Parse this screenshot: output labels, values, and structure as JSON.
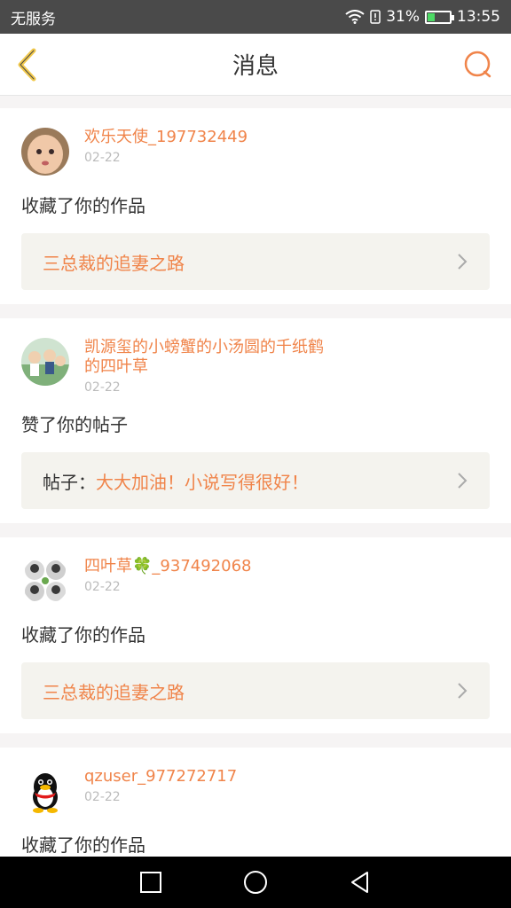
{
  "status_bar": {
    "carrier": "无服务",
    "battery": "31%",
    "time": "13:55"
  },
  "header": {
    "title": "消息"
  },
  "messages": [
    {
      "username": "欢乐天使_197732449",
      "date": "02-22",
      "action": "收藏了你的作品",
      "target_prefix": "",
      "target": "三总裁的追妻之路"
    },
    {
      "username": "凯源玺的小螃蟹的小汤圆的千纸鹤的四叶草",
      "date": "02-22",
      "action": "赞了你的帖子",
      "target_prefix": "帖子：",
      "target": "大大加油！小说写得很好！"
    },
    {
      "username": "四叶草🍀_937492068",
      "date": "02-22",
      "action": "收藏了你的作品",
      "target_prefix": "",
      "target": "三总裁的追妻之路"
    },
    {
      "username": "qzuser_977272717",
      "date": "02-22",
      "action": "收藏了你的作品",
      "target_prefix": "",
      "target": ""
    }
  ],
  "colors": {
    "accent": "#f0844a",
    "back_icon": "#f2c94c"
  },
  "icons": [
    "back-icon",
    "search-icon",
    "chevron-right-icon",
    "square-nav-icon",
    "circle-nav-icon",
    "back-nav-icon"
  ]
}
